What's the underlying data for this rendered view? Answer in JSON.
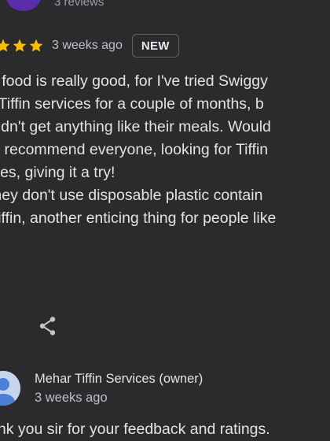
{
  "header": {
    "reviews_count": "3 reviews"
  },
  "review": {
    "stars_visible": 3,
    "star_color": "#fbbc04",
    "time": "3 weeks ago",
    "badge": "NEW",
    "text_lines": [
      "e food is really good, for I've tried Swiggy",
      "r Tiffin services for a couple of months, b",
      "didn't get anything like their meals. Would",
      "ly recommend everyone, looking for Tiffin",
      "ices, giving it a try!",
      " they don't use disposable plastic contain",
      "Tiffin, another enticing thing for people like"
    ]
  },
  "actions": {
    "share_icon": "share-icon"
  },
  "owner_reply": {
    "name": "Mehar Tiffin Services (owner)",
    "time": "3 weeks ago",
    "text": "ank you sir for your feedback and ratings."
  },
  "colors": {
    "background": "#2b2b2d",
    "avatar_top": "#5a2eaa",
    "owner_avatar_bg": "#c6d4f0",
    "owner_avatar_fg": "#4d7fd6"
  }
}
